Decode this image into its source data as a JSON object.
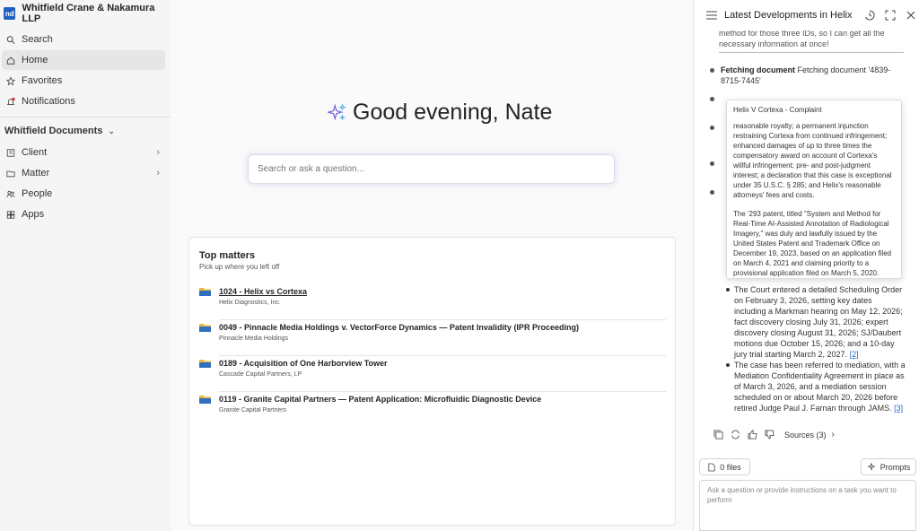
{
  "sidebar": {
    "brand_logo": "nd",
    "brand_name": "Whitfield Crane & Nakamura LLP",
    "items": [
      {
        "label": "Search",
        "icon": "search-icon"
      },
      {
        "label": "Home",
        "icon": "home-icon",
        "active": true
      },
      {
        "label": "Favorites",
        "icon": "star-icon"
      },
      {
        "label": "Notifications",
        "icon": "bell-icon"
      }
    ],
    "section_title": "Whitfield Documents",
    "doc_items": [
      {
        "label": "Client",
        "icon": "client-icon"
      },
      {
        "label": "Matter",
        "icon": "folder-icon"
      },
      {
        "label": "People",
        "icon": "people-icon"
      },
      {
        "label": "Apps",
        "icon": "apps-icon"
      }
    ]
  },
  "main": {
    "greeting": "Good evening, Nate",
    "search_placeholder": "Search or ask a question...",
    "top_matters": {
      "title": "Top matters",
      "subtitle": "Pick up where you left off",
      "items": [
        {
          "title": "1024 - Helix vs Cortexa",
          "client": "Helix Diagnostics, Inc."
        },
        {
          "title": "0049 - Pinnacle Media Holdings v. VectorForce Dynamics — Patent Invalidity (IPR Proceeding)",
          "client": "Pinnacle Media Holdings"
        },
        {
          "title": "0189 - Acquisition of One Harborview Tower",
          "client": "Cascade Capital Partners, LP"
        },
        {
          "title": "0119 - Granite Capital Partners — Patent Application: Microfluidic Diagnostic Device",
          "client": "Granite Capital Partners"
        }
      ]
    }
  },
  "panel": {
    "title": "Latest Developments in Helix v ...",
    "quote": "method for those three IDs, so I can get all the necessary information at once!",
    "steps": [
      {
        "label": "Fetching document",
        "text": " Fetching document '4839-8715-7445'"
      }
    ],
    "tooltip": {
      "title": "Helix V Cortexa - Complaint",
      "p1": "reasonable royalty; a permanent injunction restraining Cortexa from continued infringement; enhanced damages of up to three times the compensatory award on account of Cortexa's willful infringement; pre- and post-judgment interest; a declaration that this case is exceptional under 35 U.S.C. § 285; and Helix's reasonable attorneys' fees and costs.",
      "p2": "The '293 patent, titled \"System and Method for Real-Time AI-Assisted Annotation of Radiological Imagery,\" was duly and lawfully issued by the United States Patent and Trademark Office on December 19, 2023, based on an application filed on March 4, 2021 and claiming priority to a provisional application filed on March 5, 2020."
    },
    "bullets": [
      {
        "text": "The Court entered a detailed Scheduling Order on February 3, 2026, setting key dates including a Markman hearing on May 12, 2026; fact discovery closing July 31, 2026; expert discovery closing August 31, 2026; SJ/Daubert motions due October 15, 2026; and a 10-day jury trial starting March 2, 2027.",
        "cite": "[2]"
      },
      {
        "text": "The case has been referred to mediation, with a Mediation Confidentiality Agreement in place as of March 3, 2026, and a mediation session scheduled on or about March 20, 2026 before retired Judge Paul J. Farnan through JAMS.",
        "cite": "[3]"
      }
    ],
    "sources_label": "Sources (3)",
    "files_label": "0 files",
    "prompts_label": "Prompts",
    "ask_placeholder": "Ask a question or provide instructions on a task you want to perform"
  }
}
